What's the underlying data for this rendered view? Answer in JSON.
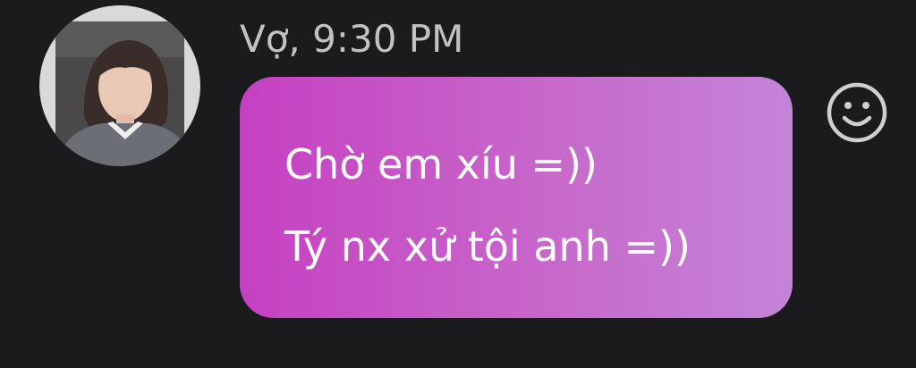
{
  "message": {
    "sender": "Vợ",
    "time": "9:30 PM",
    "header": "Vợ, 9:30 PM",
    "lines": [
      "Chờ em xíu =))",
      "Tý nx xử tội anh =))"
    ]
  },
  "avatar": {
    "icon": "profile-photo"
  },
  "reaction": {
    "icon": "smiley-face-icon"
  },
  "colors": {
    "background": "#1b1a1d",
    "bubble_start": "#c640c2",
    "bubble_end": "#c484d6",
    "meta_text": "#c2c2c2",
    "message_text": "#ffffff",
    "icon_stroke": "#cfcfcf"
  }
}
